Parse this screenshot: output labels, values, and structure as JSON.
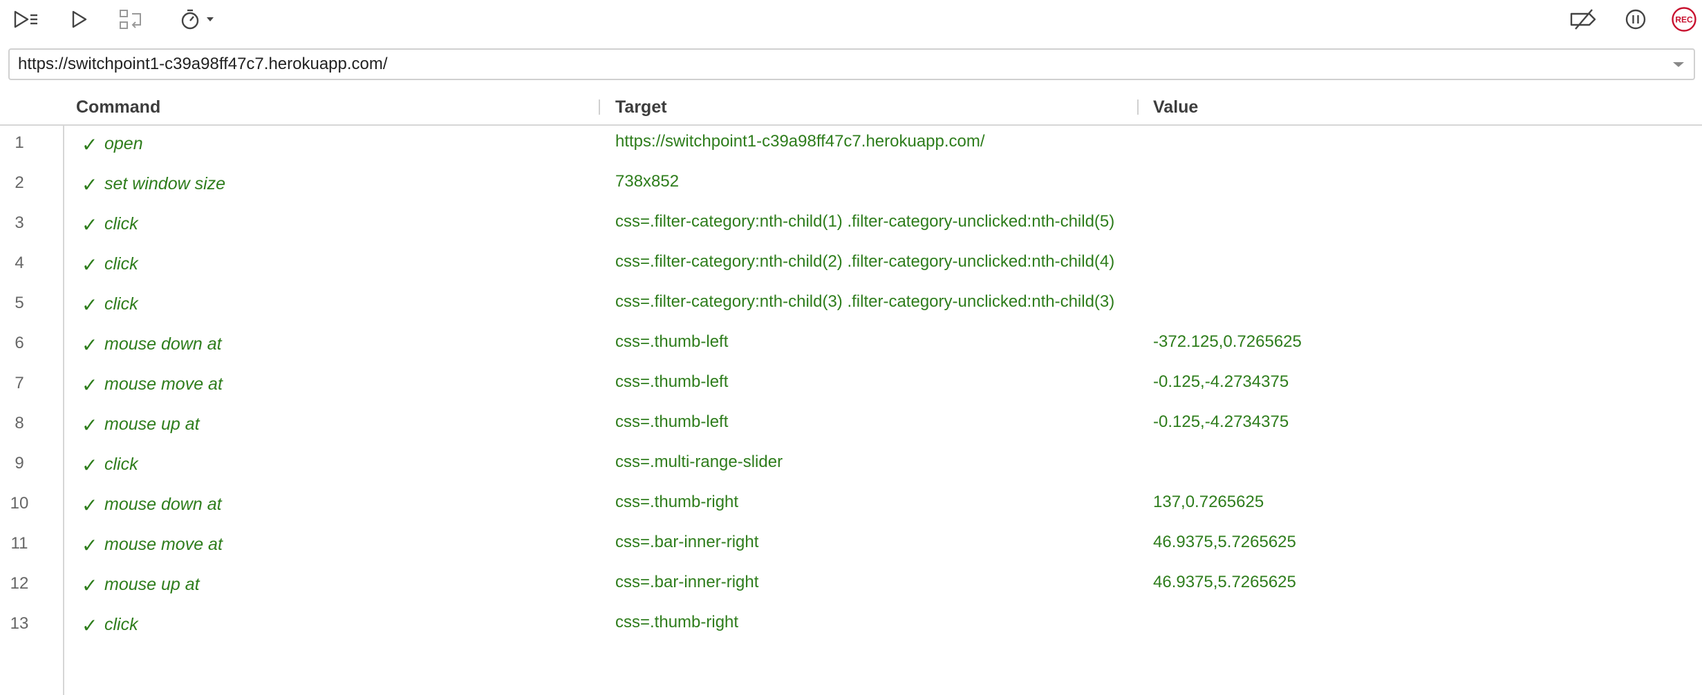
{
  "toolbar": {
    "left_buttons": [
      {
        "name": "run-all-tests-icon"
      },
      {
        "name": "run-current-test-icon"
      },
      {
        "name": "record-disabled-icon"
      },
      {
        "name": "test-execution-speed-icon"
      }
    ],
    "right_buttons": [
      {
        "name": "disable-breakpoints-icon"
      },
      {
        "name": "pause-on-exceptions-icon"
      },
      {
        "name": "record-button",
        "label": "REC"
      }
    ]
  },
  "url_bar": {
    "value": "https://switchpoint1-c39a98ff47c7.herokuapp.com/"
  },
  "grid": {
    "columns": {
      "command": "Command",
      "target": "Target",
      "value": "Value"
    },
    "rows": [
      {
        "num": "1",
        "command": "open",
        "target": "https://switchpoint1-c39a98ff47c7.herokuapp.com/",
        "value": ""
      },
      {
        "num": "2",
        "command": "set window size",
        "target": "738x852",
        "value": ""
      },
      {
        "num": "3",
        "command": "click",
        "target": "css=.filter-category:nth-child(1) .filter-category-unclicked:nth-child(5)",
        "value": ""
      },
      {
        "num": "4",
        "command": "click",
        "target": "css=.filter-category:nth-child(2) .filter-category-unclicked:nth-child(4)",
        "value": ""
      },
      {
        "num": "5",
        "command": "click",
        "target": "css=.filter-category:nth-child(3) .filter-category-unclicked:nth-child(3)",
        "value": ""
      },
      {
        "num": "6",
        "command": "mouse down at",
        "target": "css=.thumb-left",
        "value": "-372.125,0.7265625"
      },
      {
        "num": "7",
        "command": "mouse move at",
        "target": "css=.thumb-left",
        "value": "-0.125,-4.2734375"
      },
      {
        "num": "8",
        "command": "mouse up at",
        "target": "css=.thumb-left",
        "value": "-0.125,-4.2734375"
      },
      {
        "num": "9",
        "command": "click",
        "target": "css=.multi-range-slider",
        "value": ""
      },
      {
        "num": "10",
        "command": "mouse down at",
        "target": "css=.thumb-right",
        "value": "137,0.7265625"
      },
      {
        "num": "11",
        "command": "mouse move at",
        "target": "css=.bar-inner-right",
        "value": "46.9375,5.7265625"
      },
      {
        "num": "12",
        "command": "mouse up at",
        "target": "css=.bar-inner-right",
        "value": "46.9375,5.7265625"
      },
      {
        "num": "13",
        "command": "click",
        "target": "css=.thumb-right",
        "value": ""
      }
    ]
  },
  "colors": {
    "command_text": "#2e7d1c",
    "record_red": "#c8102e",
    "icon_gray": "#444444"
  }
}
